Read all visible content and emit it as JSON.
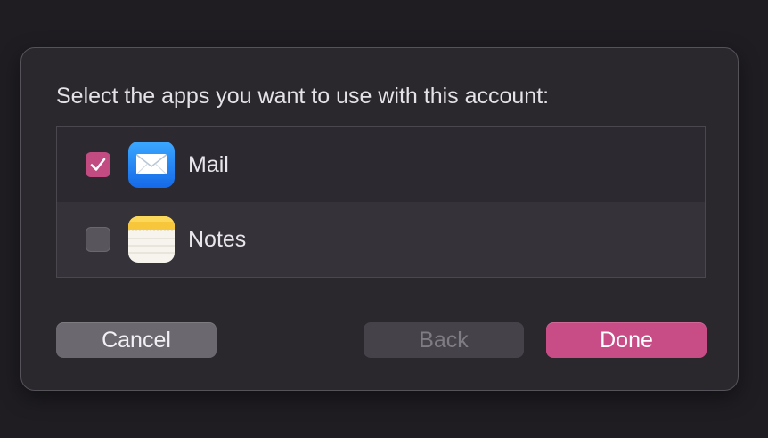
{
  "dialog": {
    "prompt": "Select the apps you want to use with this account:",
    "apps": [
      {
        "name": "Mail",
        "checked": true,
        "icon": "mail-icon"
      },
      {
        "name": "Notes",
        "checked": false,
        "icon": "notes-icon"
      }
    ],
    "buttons": {
      "cancel": "Cancel",
      "back": "Back",
      "done": "Done"
    }
  },
  "colors": {
    "accent": "#c84d86",
    "checkbox_checked": "#c24b82",
    "dialog_bg": "#2a272d",
    "window_bg": "#1f1d22"
  }
}
